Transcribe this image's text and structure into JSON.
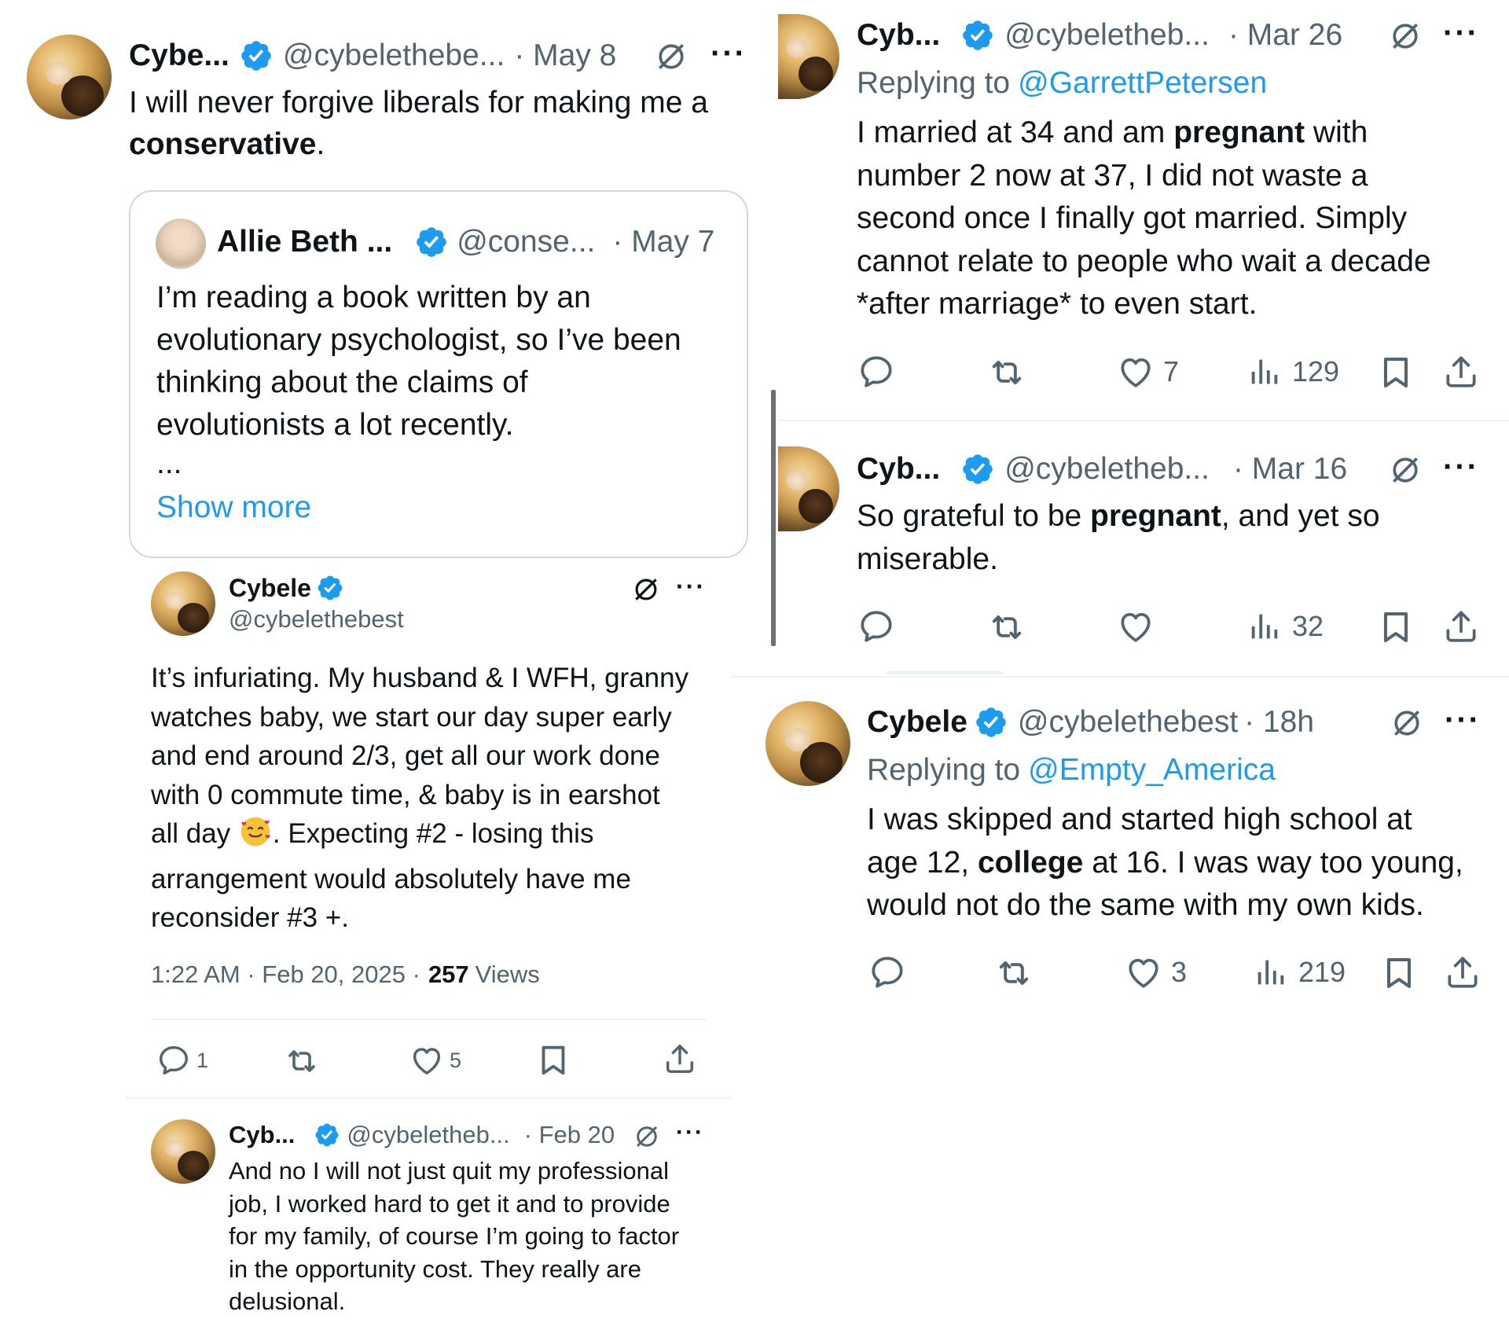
{
  "t1": {
    "name": "Cybe...",
    "handle": "@cybelethebe...",
    "date": "· May 8",
    "text_pre": "I will never forgive liberals for making me a",
    "text_bold": "conservative",
    "text_post": "."
  },
  "quote": {
    "name": "Allie Beth ...",
    "handle": "@conse...",
    "date": "· May 7",
    "line1": "I’m reading a book written by an",
    "line2": "evolutionary psychologist, so I’ve been",
    "line3": "thinking about the claims of",
    "line4": "evolutionists a lot recently.",
    "ellipsis": "...",
    "show_more": "Show more"
  },
  "t2": {
    "name": "Cybele",
    "handle": "@cybelethebest",
    "l1": "It’s infuriating. My husband & I WFH, granny",
    "l2": "watches baby, we start our day super early",
    "l3": "and end around 2/3, get all our work done",
    "l4": "with 0 commute time, & baby is in earshot",
    "l5a": "all day",
    "l5b": ". Expecting #2 - losing this",
    "l6": "arrangement would absolutely have me",
    "l7": "reconsider #3 +.",
    "meta_time": "1:22 AM · Feb 20, 2025 ·",
    "views_num": "257",
    "views_label": "Views",
    "replies": "1",
    "likes": "5"
  },
  "t3": {
    "name": "Cyb...",
    "handle": "@cybeletheb...",
    "date": "· Feb 20",
    "l1": "And no I will not just quit my professional",
    "l2": "job, I worked hard to get it and to provide",
    "l3": "for my family, of course I’m going to factor",
    "l4": "in the opportunity cost. They really are",
    "l5": "delusional."
  },
  "t4": {
    "name": "Cyb...",
    "handle": "@cybeletheb...",
    "date": "· Mar 26",
    "reply_prefix": "Replying to",
    "reply_to": "@GarrettPetersen",
    "l1_pre": "I married at 34 and am",
    "l1_bold": "pregnant",
    "l1_post": "with",
    "l2": "number 2 now at 37, I did not waste a",
    "l3": "second once I finally got married. Simply",
    "l4": "cannot relate to people who wait a decade",
    "l5": "*after marriage* to even start.",
    "likes": "7",
    "views": "129"
  },
  "t5": {
    "name": "Cyb...",
    "handle": "@cybeletheb...",
    "date": "· Mar 16",
    "l1_pre": "So grateful to be",
    "l1_bold": "pregnant",
    "l1_post": ", and yet so",
    "l2": "miserable.",
    "views": "32"
  },
  "t6": {
    "name": "Cybele",
    "handle": "@cybelethebest",
    "date": "· 18h",
    "reply_prefix": "Replying to",
    "reply_to": "@Empty_America",
    "l1": "I was skipped and started high school at",
    "l2_pre": "age 12,",
    "l2_bold": "college",
    "l2_post": "at 16. I was way too young,",
    "l3": "would not do the same with my own kids.",
    "likes": "3",
    "views": "219"
  },
  "icons": {
    "verified": "verified-badge-icon",
    "grok": "grok-icon",
    "more": "more-icon",
    "reply": "reply-icon",
    "retweet": "retweet-icon",
    "like": "like-icon",
    "views": "views-icon",
    "bookmark": "bookmark-icon",
    "share": "share-icon"
  },
  "colors": {
    "link": "#1d9bf0",
    "verified": "#1d9bf0",
    "muted": "#536471",
    "text": "#0f1419"
  }
}
